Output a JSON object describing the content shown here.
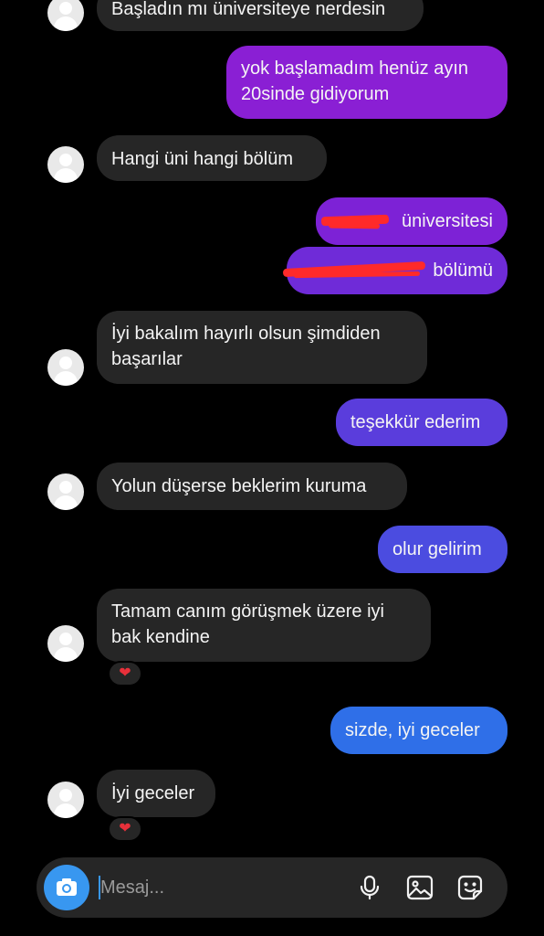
{
  "messages": [
    {
      "side": "in",
      "text": "Başladın mı üniversiteye nerdesin"
    },
    {
      "side": "out",
      "line1": "yok başlamadım henüz ayın",
      "line2": "20sinde gidiyorum"
    },
    {
      "side": "in",
      "text": "Hangi üni hangi bölüm"
    },
    {
      "side": "out",
      "text": "üniversitesi"
    },
    {
      "side": "out",
      "text": "bölümü"
    },
    {
      "side": "in",
      "line1": "İyi bakalım hayırlı olsun şimdiden",
      "line2": "başarılar"
    },
    {
      "side": "out",
      "text": "teşekkür ederim"
    },
    {
      "side": "in",
      "text": "Yolun düşerse beklerim kuruma"
    },
    {
      "side": "out",
      "text": "olur gelirim"
    },
    {
      "side": "in",
      "line1": "Tamam canım görüşmek üzere iyi",
      "line2": "bak kendine",
      "reaction": "❤"
    },
    {
      "side": "out",
      "text": "sizde, iyi geceler"
    },
    {
      "side": "in",
      "text": "İyi geceler",
      "reaction": "❤"
    }
  ],
  "composer": {
    "placeholder": "Mesaj...",
    "icons": [
      "camera-icon",
      "microphone-icon",
      "gallery-icon",
      "sticker-icon"
    ]
  },
  "colors": {
    "incoming_bubble": "#262626",
    "outgoing_purple": "#8a1fd4",
    "outgoing_violet": "#6d33d8",
    "outgoing_indigo": "#4b4ce0",
    "outgoing_blue": "#2f6fe8",
    "camera_button": "#3897f0",
    "heart": "#e8303a",
    "redaction": "#ff2a2a"
  }
}
